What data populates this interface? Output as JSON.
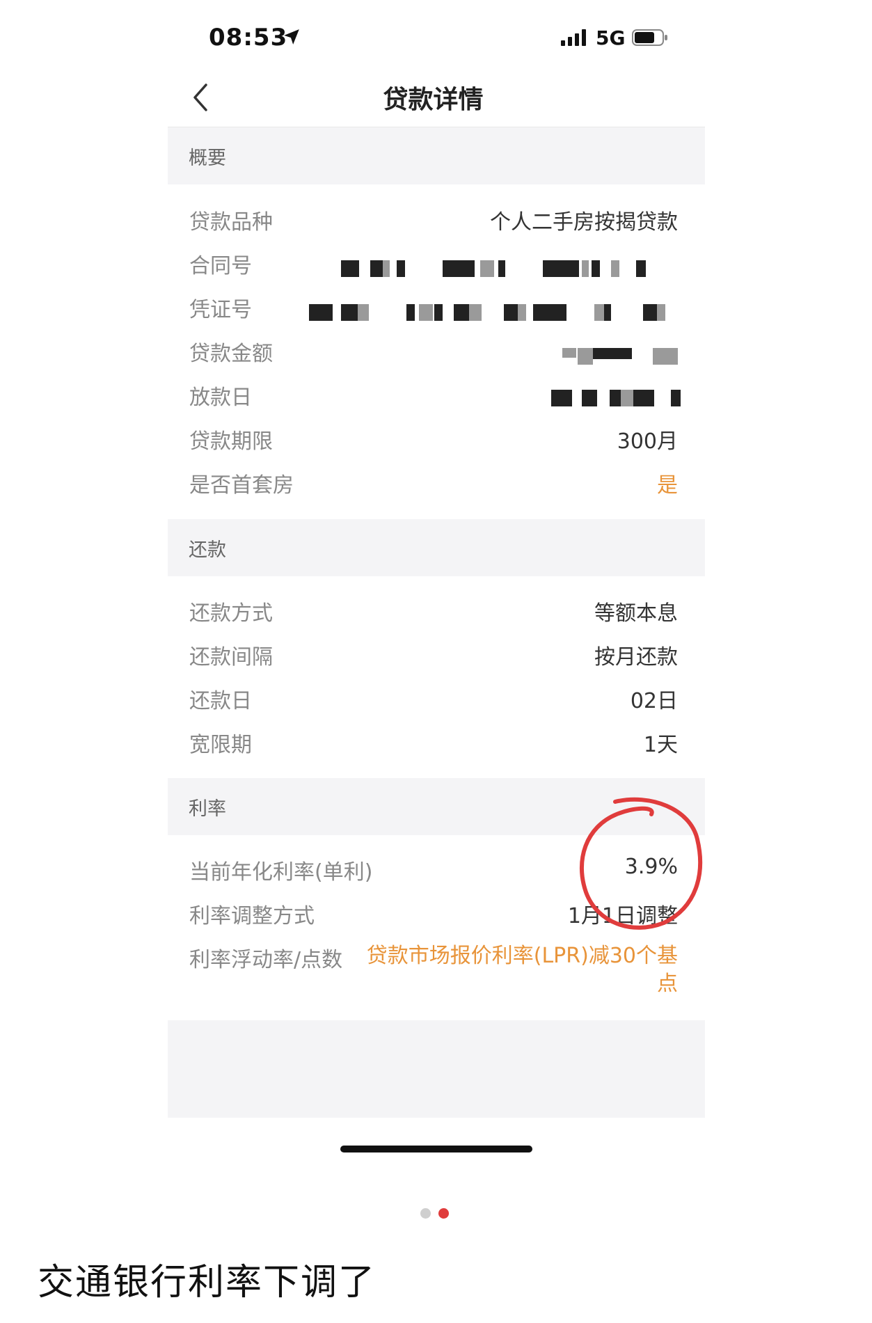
{
  "status_bar": {
    "time": "08:53",
    "network": "5G",
    "icons": [
      "location-arrow-icon",
      "signal-icon",
      "battery-icon"
    ]
  },
  "nav": {
    "title": "贷款详情",
    "back_icon": "chevron-left-icon"
  },
  "overview": {
    "header": "概要",
    "rows": [
      {
        "label": "贷款品种",
        "value": "个人二手房按揭贷款"
      },
      {
        "label": "合同号",
        "value": ""
      },
      {
        "label": "凭证号",
        "value": ""
      },
      {
        "label": "贷款金额",
        "value": ""
      },
      {
        "label": "放款日",
        "value": ""
      },
      {
        "label": "贷款期限",
        "value": "300月"
      },
      {
        "label": "是否首套房",
        "value": "是"
      }
    ]
  },
  "repayment": {
    "header": "还款",
    "rows": [
      {
        "label": "还款方式",
        "value": "等额本息"
      },
      {
        "label": "还款间隔",
        "value": "按月还款"
      },
      {
        "label": "还款日",
        "value": "02日"
      },
      {
        "label": "宽限期",
        "value": "1天"
      }
    ]
  },
  "rate": {
    "header": "利率",
    "rows": [
      {
        "label": "当前年化利率(单利)",
        "value": "3.9%"
      },
      {
        "label": "利率调整方式",
        "value": "1月1日调整"
      },
      {
        "label": "利率浮动率/点数",
        "value": "贷款市场报价利率(LPR)减30个基点"
      }
    ]
  },
  "colors": {
    "accent_orange": "#e8943a",
    "annotation_red": "#e03c3c",
    "section_bg": "#f4f4f6"
  },
  "pager": {
    "count": 2,
    "active_index": 1
  },
  "caption": "交通银行利率下调了"
}
